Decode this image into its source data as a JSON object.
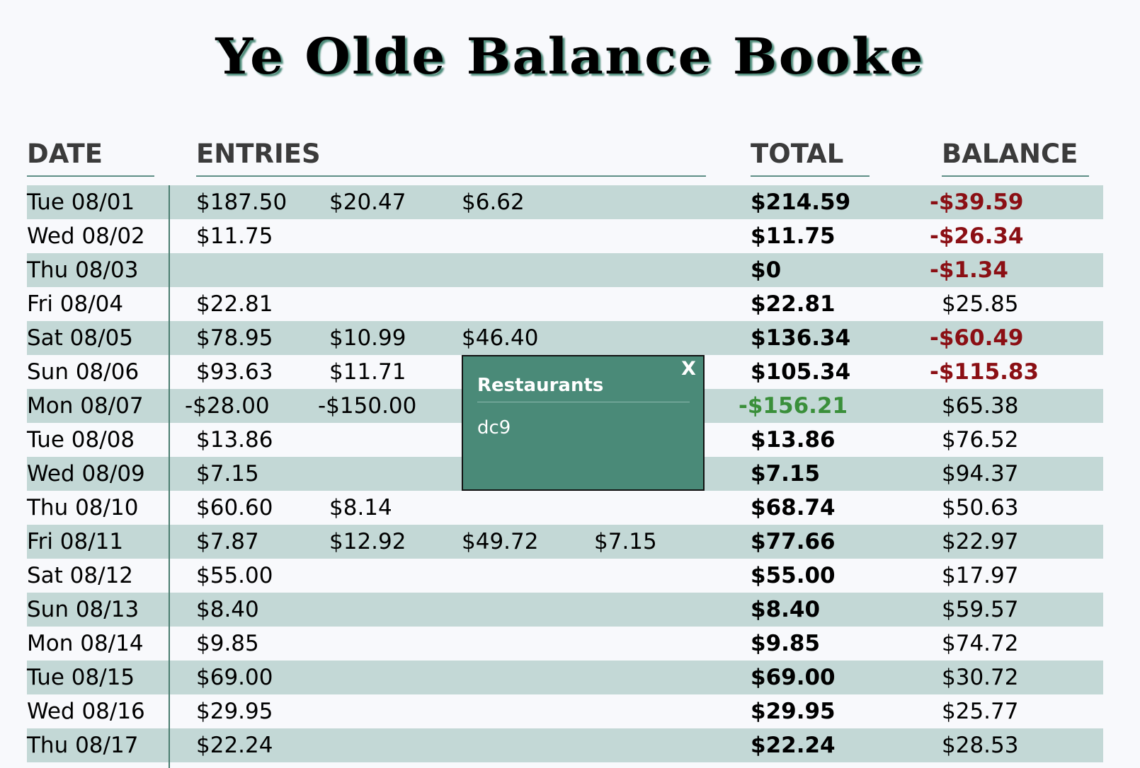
{
  "title": "Ye Olde Balance Booke",
  "headers": {
    "date": "DATE",
    "entries": "ENTRIES",
    "total": "TOTAL",
    "balance": "BALANCE"
  },
  "rows": [
    {
      "date": "Tue 08/01",
      "entries": [
        "$187.50",
        "$20.47",
        "$6.62"
      ],
      "total": "$214.59",
      "balance": "-$39.59",
      "balance_negative": true
    },
    {
      "date": "Wed 08/02",
      "entries": [
        "$11.75"
      ],
      "total": "$11.75",
      "balance": "-$26.34",
      "balance_negative": true
    },
    {
      "date": "Thu 08/03",
      "entries": [],
      "total": "$0",
      "balance": "-$1.34",
      "balance_negative": true
    },
    {
      "date": "Fri 08/04",
      "entries": [
        "$22.81"
      ],
      "total": "$22.81",
      "balance": "$25.85",
      "balance_negative": false
    },
    {
      "date": "Sat 08/05",
      "entries": [
        "$78.95",
        "$10.99",
        "$46.40"
      ],
      "total": "$136.34",
      "balance": "-$60.49",
      "balance_negative": true
    },
    {
      "date": "Sun 08/06",
      "entries": [
        "$93.63",
        "$11.71"
      ],
      "total": "$105.34",
      "balance": "-$115.83",
      "balance_negative": true
    },
    {
      "date": "Mon 08/07",
      "entries": [
        "-$28.00",
        "-$150.00"
      ],
      "total": "-$156.21",
      "total_negative": true,
      "balance": "$65.38",
      "balance_negative": false
    },
    {
      "date": "Tue 08/08",
      "entries": [
        "$13.86"
      ],
      "total": "$13.86",
      "balance": "$76.52",
      "balance_negative": false
    },
    {
      "date": "Wed 08/09",
      "entries": [
        "$7.15"
      ],
      "total": "$7.15",
      "balance": "$94.37",
      "balance_negative": false
    },
    {
      "date": "Thu 08/10",
      "entries": [
        "$60.60",
        "$8.14"
      ],
      "total": "$68.74",
      "balance": "$50.63",
      "balance_negative": false
    },
    {
      "date": "Fri 08/11",
      "entries": [
        "$7.87",
        "$12.92",
        "$49.72",
        "$7.15"
      ],
      "total": "$77.66",
      "balance": "$22.97",
      "balance_negative": false
    },
    {
      "date": "Sat 08/12",
      "entries": [
        "$55.00"
      ],
      "total": "$55.00",
      "balance": "$17.97",
      "balance_negative": false
    },
    {
      "date": "Sun 08/13",
      "entries": [
        "$8.40"
      ],
      "total": "$8.40",
      "balance": "$59.57",
      "balance_negative": false
    },
    {
      "date": "Mon 08/14",
      "entries": [
        "$9.85"
      ],
      "total": "$9.85",
      "balance": "$74.72",
      "balance_negative": false
    },
    {
      "date": "Tue 08/15",
      "entries": [
        "$69.00"
      ],
      "total": "$69.00",
      "balance": "$30.72",
      "balance_negative": false
    },
    {
      "date": "Wed 08/16",
      "entries": [
        "$29.95"
      ],
      "total": "$29.95",
      "balance": "$25.77",
      "balance_negative": false
    },
    {
      "date": "Thu 08/17",
      "entries": [
        "$22.24"
      ],
      "total": "$22.24",
      "balance": "$28.53",
      "balance_negative": false
    }
  ],
  "popup": {
    "title": "Restaurants",
    "body": "dc9",
    "close_label": "X"
  },
  "colors": {
    "negative": "#8b0f14",
    "credit": "#3a8f3a",
    "row_shade": "#c3d8d6",
    "popup_bg": "#4a8a78"
  }
}
